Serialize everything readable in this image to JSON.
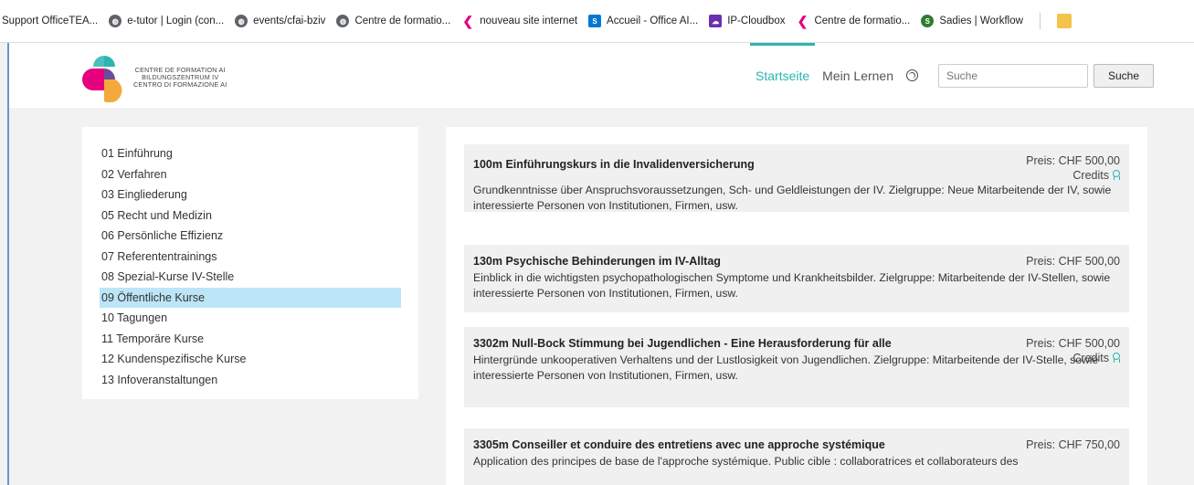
{
  "bookmarks": [
    {
      "label": "Support OfficeTEA...",
      "icon": "none",
      "color": "#ffffff"
    },
    {
      "label": "e-tutor | Login (con...",
      "icon": "globe-icon",
      "color": "#5f6368"
    },
    {
      "label": "events/cfai-bziv",
      "icon": "globe-icon",
      "color": "#5f6368"
    },
    {
      "label": "Centre de formatio...",
      "icon": "globe-icon",
      "color": "#5f6368"
    },
    {
      "label": "nouveau site internet",
      "icon": "cfai-logo-icon",
      "color": "#e6007e"
    },
    {
      "label": "Accueil - Office AI...",
      "icon": "sharepoint-icon",
      "color": "#0078d4"
    },
    {
      "label": "IP-Cloudbox",
      "icon": "cloudbox-icon",
      "color": "#6b2fb3"
    },
    {
      "label": "Centre de formatio...",
      "icon": "cfai-logo-icon",
      "color": "#e6007e"
    },
    {
      "label": "Sadies | Workflow",
      "icon": "sadies-icon",
      "color": "#2e7d32"
    }
  ],
  "logo": {
    "line1": "CENTRE DE FORMATION AI",
    "line2": "BILDUNGSZENTRUM IV",
    "line3": "CENTRO DI FORMAZIONE AI"
  },
  "nav": {
    "home": "Startseite",
    "my_learning": "Mein Lernen",
    "search_placeholder": "Suche",
    "search_button": "Suche"
  },
  "colors": {
    "accent": "#2bb5b0",
    "selected": "#bde5f8"
  },
  "sidebar": {
    "items": [
      {
        "label": "01 Einführung"
      },
      {
        "label": "02 Verfahren"
      },
      {
        "label": "03 Eingliederung"
      },
      {
        "label": "05 Recht und Medizin"
      },
      {
        "label": "06 Persönliche Effizienz"
      },
      {
        "label": "07 Referententrainings"
      },
      {
        "label": "08 Spezial-Kurse IV-Stelle"
      },
      {
        "label": "09 Öffentliche Kurse"
      },
      {
        "label": "10 Tagungen"
      },
      {
        "label": "11 Temporäre Kurse"
      },
      {
        "label": "12 Kundenspezifische Kurse"
      },
      {
        "label": "13 Infoveranstaltungen"
      }
    ]
  },
  "courses": [
    {
      "title": "100m Einführungskurs in die Invalidenversicherung",
      "price": "Preis: CHF 500,00",
      "credits": "Credits",
      "description": "Grundkenntnisse über Anspruchsvoraussetzungen, Sch- und Geldleistungen der IV. Zielgruppe: Neue Mitarbeitende der IV, sowie interessierte Personen von Institutionen, Firmen, usw."
    },
    {
      "title": "130m Psychische Behinderungen im IV-Alltag",
      "price": "Preis: CHF 500,00",
      "credits": "",
      "description": "Einblick in die wichtigsten psychopathologischen Symptome und Krankheitsbilder. Zielgruppe: Mitarbeitende der IV-Stellen, sowie interessierte Personen von Institutionen, Firmen, usw."
    },
    {
      "title": "3302m Null-Bock Stimmung bei Jugendlichen - Eine Herausforderung für alle",
      "price": "Preis: CHF 500,00",
      "credits": "Credits",
      "description": "Hintergründe unkooperativen Verhaltens und der Lustlosigkeit von Jugendlichen. Zielgruppe: Mitarbeitende der IV-Stelle, sowie interessierte Personen von Institutionen, Firmen, usw."
    },
    {
      "title": "3305m Conseiller et conduire des entretiens avec une approche systémique",
      "price": "Preis: CHF 750,00",
      "credits": "",
      "description": "Application des principes de base de l'approche systémique. Public cible : collaboratrices et collaborateurs des"
    }
  ]
}
